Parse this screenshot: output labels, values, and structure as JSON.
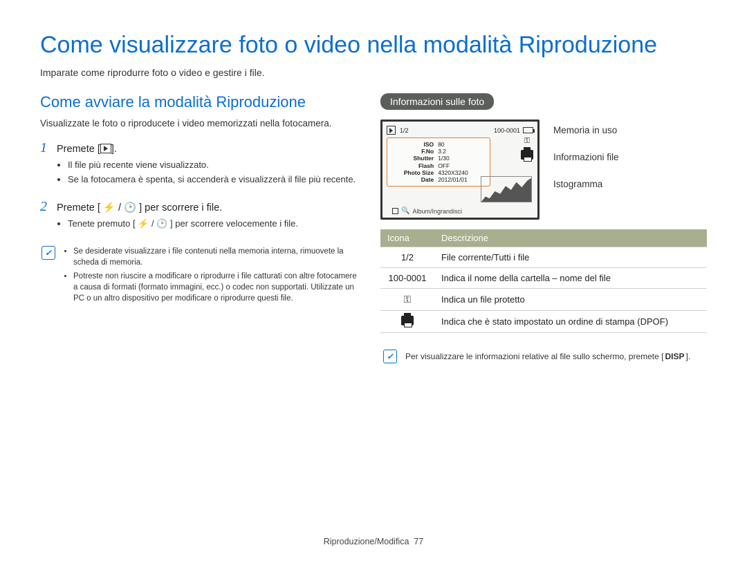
{
  "title": "Come visualizzare foto o video nella modalità Riproduzione",
  "intro": "Imparate come riprodurre foto o video e gestire i file.",
  "left": {
    "subhead": "Come avviare la modalità Riproduzione",
    "para": "Visualizzate le foto o riproducete i video memorizzati nella fotocamera.",
    "step1": {
      "num": "1",
      "text_pre": "Premete [",
      "text_post": "]."
    },
    "step1_bullets": [
      "Il file più recente viene visualizzato.",
      "Se la fotocamera è spenta, si accenderà e visualizzerà il file più recente."
    ],
    "step2": {
      "num": "2",
      "text": "Premete [ ⚡ / 🕑 ] per scorrere i file."
    },
    "step2_bullets": [
      "Tenete premuto [ ⚡ / 🕑 ] per scorrere velocemente i file."
    ],
    "note": [
      "Se desiderate visualizzare i file contenuti nella memoria interna, rimuovete la scheda di memoria.",
      "Potreste non riuscire a modificare o riprodurre i file catturati con altre fotocamere a causa di formati (formato immagini, ecc.) o codec non supportati. Utilizzate un PC o un altro dispositivo per modificare o riprodurre questi file."
    ]
  },
  "right": {
    "pill": "Informazioni sulle foto",
    "lcd": {
      "counter": "1/2",
      "file_no": "100-0001",
      "info_rows": [
        {
          "k": "ISO",
          "v": "80"
        },
        {
          "k": "F.No",
          "v": "3.2"
        },
        {
          "k": "Shutter",
          "v": "1/30"
        },
        {
          "k": "Flash",
          "v": "OFF"
        },
        {
          "k": "Photo Size",
          "v": "4320X3240"
        },
        {
          "k": "Date",
          "v": "2012/01/01"
        }
      ],
      "bottom_label": "Album/Ingrandisci"
    },
    "callouts": {
      "memory": "Memoria in uso",
      "info": "Informazioni file",
      "histo": "Istogramma"
    },
    "table": {
      "head_icon": "Icona",
      "head_desc": "Descrizione",
      "rows": [
        {
          "icon_text": "1/2",
          "desc": "File corrente/Tutti i file"
        },
        {
          "icon_text": "100-0001",
          "desc": "Indica il nome della cartella – nome del file"
        },
        {
          "icon_kind": "key",
          "desc": "Indica un file protetto"
        },
        {
          "icon_kind": "printer",
          "desc": "Indica che è stato impostato un ordine di stampa (DPOF)"
        }
      ]
    },
    "note2_pre": "Per visualizzare le informazioni relative al file sullo schermo, premete [",
    "note2_btn": "DISP",
    "note2_post": "]."
  },
  "footer": {
    "section": "Riproduzione/Modifica",
    "page": "77"
  }
}
